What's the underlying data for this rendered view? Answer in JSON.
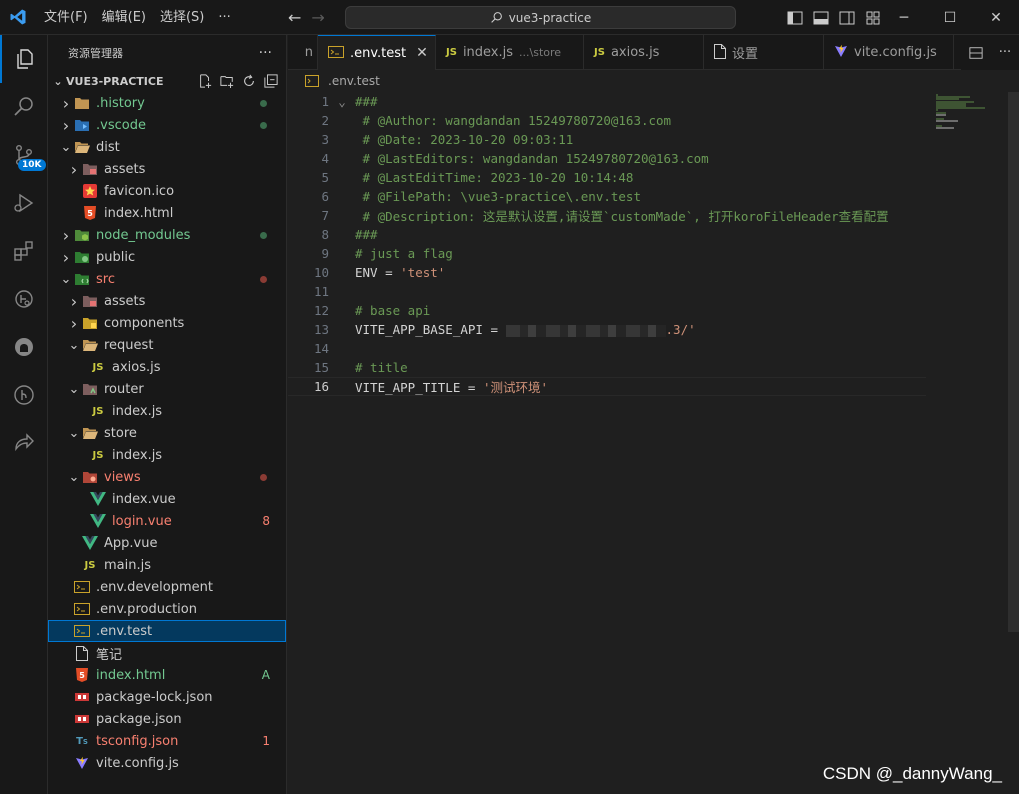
{
  "titlebar": {
    "menu": [
      "文件(F)",
      "编辑(E)",
      "选择(S)",
      "···"
    ],
    "search": "vue3-practice"
  },
  "activity": {
    "badge": "10K",
    "items": [
      "explorer-icon",
      "search-icon",
      "source-control-icon",
      "run-debug-icon",
      "extensions-icon",
      "remote-explorer-icon",
      "github-icon",
      "git-graph-icon",
      "live-share-icon"
    ]
  },
  "sidebar": {
    "header": "资源管理器",
    "more": "···",
    "root": "VUE3-PRACTICE",
    "tree": [
      {
        "label": ".history",
        "depth": 0,
        "chev": "right",
        "icon": "folder",
        "color": "green",
        "dot": "green"
      },
      {
        "label": ".vscode",
        "depth": 0,
        "chev": "right",
        "icon": "folder-vscode",
        "color": "green",
        "dot": "green"
      },
      {
        "label": "dist",
        "depth": 0,
        "chev": "down",
        "icon": "folder-open",
        "color": "",
        "dot": ""
      },
      {
        "label": "assets",
        "depth": 1,
        "chev": "right",
        "icon": "folder-assets",
        "color": "",
        "dot": ""
      },
      {
        "label": "favicon.ico",
        "depth": 1,
        "chev": "",
        "icon": "favicon",
        "color": "",
        "dot": ""
      },
      {
        "label": "index.html",
        "depth": 1,
        "chev": "",
        "icon": "html",
        "color": "",
        "dot": ""
      },
      {
        "label": "node_modules",
        "depth": 0,
        "chev": "right",
        "icon": "folder-node",
        "color": "green",
        "dot": "green"
      },
      {
        "label": "public",
        "depth": 0,
        "chev": "right",
        "icon": "folder-public",
        "color": "",
        "dot": ""
      },
      {
        "label": "src",
        "depth": 0,
        "chev": "down",
        "icon": "folder-src",
        "color": "red",
        "dot": "red"
      },
      {
        "label": "assets",
        "depth": 1,
        "chev": "right",
        "icon": "folder-assets",
        "color": "",
        "dot": ""
      },
      {
        "label": "components",
        "depth": 1,
        "chev": "right",
        "icon": "folder-components",
        "color": "",
        "dot": ""
      },
      {
        "label": "request",
        "depth": 1,
        "chev": "down",
        "icon": "folder-open",
        "color": "",
        "dot": ""
      },
      {
        "label": "axios.js",
        "depth": 2,
        "chev": "",
        "icon": "js",
        "color": "",
        "dot": ""
      },
      {
        "label": "router",
        "depth": 1,
        "chev": "down",
        "icon": "folder-router",
        "color": "",
        "dot": ""
      },
      {
        "label": "index.js",
        "depth": 2,
        "chev": "",
        "icon": "js",
        "color": "",
        "dot": ""
      },
      {
        "label": "store",
        "depth": 1,
        "chev": "down",
        "icon": "folder-open",
        "color": "",
        "dot": ""
      },
      {
        "label": "index.js",
        "depth": 2,
        "chev": "",
        "icon": "js",
        "color": "",
        "dot": ""
      },
      {
        "label": "views",
        "depth": 1,
        "chev": "down",
        "icon": "folder-views",
        "color": "red",
        "dot": "red"
      },
      {
        "label": "index.vue",
        "depth": 2,
        "chev": "",
        "icon": "vue",
        "color": "",
        "dot": ""
      },
      {
        "label": "login.vue",
        "depth": 2,
        "chev": "",
        "icon": "vue",
        "color": "red",
        "deco": "8"
      },
      {
        "label": "App.vue",
        "depth": 1,
        "chev": "",
        "icon": "vue",
        "color": "",
        "dot": ""
      },
      {
        "label": "main.js",
        "depth": 1,
        "chev": "",
        "icon": "js",
        "color": "",
        "dot": ""
      },
      {
        "label": ".env.development",
        "depth": 0,
        "chev": "",
        "icon": "env",
        "color": "",
        "dot": ""
      },
      {
        "label": ".env.production",
        "depth": 0,
        "chev": "",
        "icon": "env",
        "color": "",
        "dot": ""
      },
      {
        "label": ".env.test",
        "depth": 0,
        "chev": "",
        "icon": "env",
        "color": "",
        "dot": "",
        "selected": true
      },
      {
        "label": "笔记",
        "depth": 0,
        "chev": "",
        "icon": "file",
        "color": "",
        "dot": ""
      },
      {
        "label": "index.html",
        "depth": 0,
        "chev": "",
        "icon": "html",
        "color": "green",
        "deco": "A"
      },
      {
        "label": "package-lock.json",
        "depth": 0,
        "chev": "",
        "icon": "npm",
        "color": "",
        "dot": ""
      },
      {
        "label": "package.json",
        "depth": 0,
        "chev": "",
        "icon": "npm",
        "color": "",
        "dot": ""
      },
      {
        "label": "tsconfig.json",
        "depth": 0,
        "chev": "",
        "icon": "ts",
        "color": "red",
        "deco": "1"
      },
      {
        "label": "vite.config.js",
        "depth": 0,
        "chev": "",
        "icon": "vite",
        "color": "",
        "dot": ""
      }
    ]
  },
  "tabs": [
    {
      "label": "n",
      "desc": "",
      "icon": "",
      "active": false
    },
    {
      "label": ".env.test",
      "desc": "",
      "icon": "env",
      "active": true
    },
    {
      "label": "index.js",
      "desc": "...\\store",
      "icon": "js",
      "active": false
    },
    {
      "label": "axios.js",
      "desc": "",
      "icon": "js",
      "active": false
    },
    {
      "label": "设置",
      "desc": "",
      "icon": "file",
      "active": false
    },
    {
      "label": "vite.config.js",
      "desc": "",
      "icon": "vite",
      "active": false
    }
  ],
  "breadcrumb": ".env.test",
  "editor": {
    "current_line": 16,
    "lines": [
      {
        "n": 1,
        "fold": true,
        "parts": [
          {
            "t": "###",
            "c": "comment"
          }
        ]
      },
      {
        "n": 2,
        "parts": [
          {
            "t": " # @Author: wangdandan 15249780720@163.com",
            "c": "comment"
          }
        ]
      },
      {
        "n": 3,
        "parts": [
          {
            "t": " # @Date: 2023-10-20 09:03:11",
            "c": "comment"
          }
        ]
      },
      {
        "n": 4,
        "parts": [
          {
            "t": " # @LastEditors: wangdandan 15249780720@163.com",
            "c": "comment"
          }
        ]
      },
      {
        "n": 5,
        "parts": [
          {
            "t": " # @LastEditTime: 2023-10-20 10:14:48",
            "c": "comment"
          }
        ]
      },
      {
        "n": 6,
        "parts": [
          {
            "t": " # @FilePath: \\vue3-practice\\.env.test",
            "c": "comment"
          }
        ]
      },
      {
        "n": 7,
        "parts": [
          {
            "t": " # @Description: 这是默认设置,请设置`customMade`, 打开koroFileHeader查看配置",
            "c": "comment"
          }
        ]
      },
      {
        "n": 8,
        "parts": [
          {
            "t": "###",
            "c": "comment"
          }
        ]
      },
      {
        "n": 9,
        "parts": [
          {
            "t": "# just a flag",
            "c": "comment"
          }
        ]
      },
      {
        "n": 10,
        "parts": [
          {
            "t": "ENV",
            "c": "key"
          },
          {
            "t": " = ",
            "c": "op"
          },
          {
            "t": "'test'",
            "c": "str"
          }
        ]
      },
      {
        "n": 11,
        "parts": []
      },
      {
        "n": 12,
        "parts": [
          {
            "t": "# base api",
            "c": "comment"
          }
        ]
      },
      {
        "n": 13,
        "parts": [
          {
            "t": "VITE_APP_BASE_API",
            "c": "key"
          },
          {
            "t": " = ",
            "c": "op"
          },
          {
            "t": "BLUR",
            "c": "blur"
          },
          {
            "t": ".3/'",
            "c": "str"
          }
        ]
      },
      {
        "n": 14,
        "parts": []
      },
      {
        "n": 15,
        "parts": [
          {
            "t": "# title",
            "c": "comment"
          }
        ]
      },
      {
        "n": 16,
        "parts": [
          {
            "t": "VITE_APP_TITLE",
            "c": "key"
          },
          {
            "t": " = ",
            "c": "op"
          },
          {
            "t": "'测试环境'",
            "c": "str"
          }
        ]
      }
    ]
  },
  "watermark": "CSDN @_dannyWang_"
}
